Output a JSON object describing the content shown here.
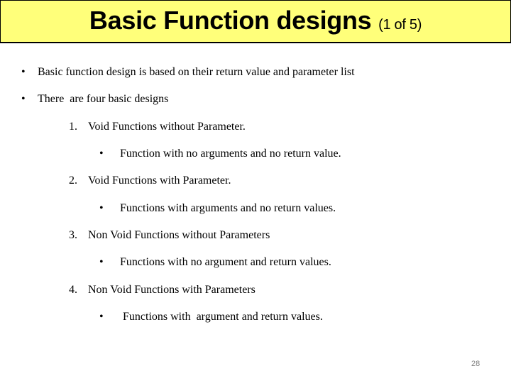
{
  "slide": {
    "title": "Basic Function designs",
    "title_suffix": "(1 of 5)",
    "bullets": [
      {
        "marker": "•",
        "text": "Basic function design is based on their return value and parameter list"
      },
      {
        "marker": "•",
        "text": "There  are four basic designs"
      }
    ],
    "designs": [
      {
        "number": "1.",
        "label": "Void Functions without Parameter.",
        "sub_marker": "•",
        "sub_text": "Function with no arguments and no return value."
      },
      {
        "number": "2.",
        "label": "Void Functions with Parameter.",
        "sub_marker": "•",
        "sub_text": "Functions with arguments and no return values."
      },
      {
        "number": "3.",
        "label": "Non Void Functions without Parameters",
        "sub_marker": "•",
        "sub_text": "Functions with no argument and return values."
      },
      {
        "number": "4.",
        "label": "Non Void Functions with Parameters",
        "sub_marker": "•",
        "sub_text": " Functions with  argument and return values."
      }
    ],
    "page_number": "28"
  },
  "colors": {
    "title_background": "#ffff7a",
    "page_number": "#808080"
  }
}
